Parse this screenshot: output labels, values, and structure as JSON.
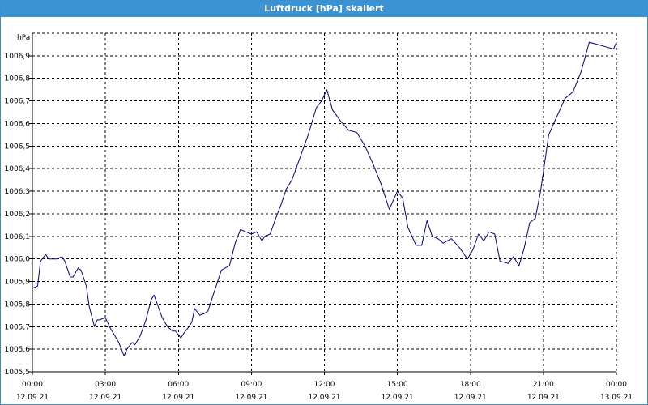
{
  "window": {
    "title": "Luftdruck [hPa] skaliert"
  },
  "chart_data": {
    "type": "line",
    "title": "Luftdruck [hPa] skaliert",
    "unit_label": "hPa",
    "xlabel": "",
    "ylabel": "",
    "ylim": [
      1005.5,
      1007.0
    ],
    "xlim": [
      "2021-09-12T00:00",
      "2021-09-13T00:00"
    ],
    "y_ticks": [
      "1005,5",
      "1005,6",
      "1005,7",
      "1005,8",
      "1005,9",
      "1006,0",
      "1006,1",
      "1006,2",
      "1006,3",
      "1006,4",
      "1006,5",
      "1006,6",
      "1006,7",
      "1006,8",
      "1006,9"
    ],
    "x_ticks": [
      {
        "time": "00:00",
        "date": "12.09.21"
      },
      {
        "time": "03:00",
        "date": "12.09.21"
      },
      {
        "time": "06:00",
        "date": "12.09.21"
      },
      {
        "time": "09:00",
        "date": "12.09.21"
      },
      {
        "time": "12:00",
        "date": "12.09.21"
      },
      {
        "time": "15:00",
        "date": "12.09.21"
      },
      {
        "time": "18:00",
        "date": "12.09.21"
      },
      {
        "time": "21:00",
        "date": "12.09.21"
      },
      {
        "time": "00:00",
        "date": "13.09.21"
      }
    ],
    "grid": true,
    "line_color": "#00008b",
    "series": [
      {
        "x": [
          "2021-09-12T00:00",
          "2021-09-12T00:13",
          "2021-09-12T00:20",
          "2021-09-12T00:33",
          "2021-09-12T00:40",
          "2021-09-12T00:46",
          "2021-09-12T01:00",
          "2021-09-12T01:13",
          "2021-09-12T01:20",
          "2021-09-12T01:33",
          "2021-09-12T01:40",
          "2021-09-12T01:53",
          "2021-09-12T02:00",
          "2021-09-12T02:13",
          "2021-09-12T02:20",
          "2021-09-12T02:33",
          "2021-09-12T02:40",
          "2021-09-12T02:46",
          "2021-09-12T03:00",
          "2021-09-12T03:13",
          "2021-09-12T03:20",
          "2021-09-12T03:33",
          "2021-09-12T03:46",
          "2021-09-12T03:53",
          "2021-09-12T04:06",
          "2021-09-12T04:13",
          "2021-09-12T04:26",
          "2021-09-12T04:40",
          "2021-09-12T04:53",
          "2021-09-12T05:00",
          "2021-09-12T05:20",
          "2021-09-12T05:33",
          "2021-09-12T05:46",
          "2021-09-12T05:53",
          "2021-09-12T06:06",
          "2021-09-12T06:13",
          "2021-09-12T06:26",
          "2021-09-12T06:33",
          "2021-09-12T06:40",
          "2021-09-12T06:53",
          "2021-09-12T07:06",
          "2021-09-12T07:13",
          "2021-09-12T07:33",
          "2021-09-12T07:46",
          "2021-09-12T08:06",
          "2021-09-12T08:13",
          "2021-09-12T08:20",
          "2021-09-12T08:33",
          "2021-09-12T08:46",
          "2021-09-12T09:00",
          "2021-09-12T09:13",
          "2021-09-12T09:26",
          "2021-09-12T09:33",
          "2021-09-12T09:46",
          "2021-09-12T10:00",
          "2021-09-12T10:13",
          "2021-09-12T10:26",
          "2021-09-12T10:40",
          "2021-09-12T11:00",
          "2021-09-12T11:20",
          "2021-09-12T11:40",
          "2021-09-12T11:53",
          "2021-09-12T12:06",
          "2021-09-12T12:20",
          "2021-09-12T12:40",
          "2021-09-12T13:00",
          "2021-09-12T13:20",
          "2021-09-12T13:40",
          "2021-09-12T14:00",
          "2021-09-12T14:20",
          "2021-09-12T14:40",
          "2021-09-12T15:00",
          "2021-09-12T15:13",
          "2021-09-12T15:26",
          "2021-09-12T15:46",
          "2021-09-12T16:00",
          "2021-09-12T16:13",
          "2021-09-12T16:26",
          "2021-09-12T16:40",
          "2021-09-12T16:53",
          "2021-09-12T17:13",
          "2021-09-12T17:33",
          "2021-09-12T17:53",
          "2021-09-12T18:06",
          "2021-09-12T18:20",
          "2021-09-12T18:33",
          "2021-09-12T18:46",
          "2021-09-12T19:00",
          "2021-09-12T19:13",
          "2021-09-12T19:33",
          "2021-09-12T19:46",
          "2021-09-12T20:00",
          "2021-09-12T20:13",
          "2021-09-12T20:26",
          "2021-09-12T20:40",
          "2021-09-12T20:53",
          "2021-09-12T21:13",
          "2021-09-12T21:33",
          "2021-09-12T21:53",
          "2021-09-12T22:13",
          "2021-09-12T22:33",
          "2021-09-12T22:53",
          "2021-09-12T23:13",
          "2021-09-12T23:33",
          "2021-09-12T23:53",
          "2021-09-13T00:00"
        ],
        "values": [
          1005.87,
          1005.88,
          1005.99,
          1006.02,
          1006.0,
          1006.0,
          1006.0,
          1006.01,
          1005.99,
          1005.92,
          1005.92,
          1005.96,
          1005.95,
          1005.88,
          1005.79,
          1005.7,
          1005.73,
          1005.73,
          1005.74,
          1005.69,
          1005.67,
          1005.63,
          1005.57,
          1005.6,
          1005.63,
          1005.62,
          1005.66,
          1005.73,
          1005.82,
          1005.84,
          1005.74,
          1005.7,
          1005.68,
          1005.68,
          1005.65,
          1005.67,
          1005.7,
          1005.72,
          1005.78,
          1005.75,
          1005.76,
          1005.77,
          1005.88,
          1005.95,
          1005.97,
          1006.02,
          1006.07,
          1006.13,
          1006.12,
          1006.11,
          1006.12,
          1006.08,
          1006.1,
          1006.11,
          1006.18,
          1006.24,
          1006.31,
          1006.35,
          1006.45,
          1006.55,
          1006.67,
          1006.7,
          1006.75,
          1006.66,
          1006.61,
          1006.57,
          1006.56,
          1006.5,
          1006.42,
          1006.33,
          1006.22,
          1006.3,
          1006.27,
          1006.14,
          1006.06,
          1006.06,
          1006.17,
          1006.1,
          1006.09,
          1006.07,
          1006.09,
          1006.05,
          1006.0,
          1006.04,
          1006.11,
          1006.08,
          1006.12,
          1006.11,
          1005.99,
          1005.98,
          1006.01,
          1005.97,
          1006.05,
          1006.16,
          1006.18,
          1006.3,
          1006.55,
          1006.63,
          1006.71,
          1006.74,
          1006.83,
          1006.96,
          1006.95,
          1006.94,
          1006.93,
          1006.96
        ]
      }
    ]
  }
}
